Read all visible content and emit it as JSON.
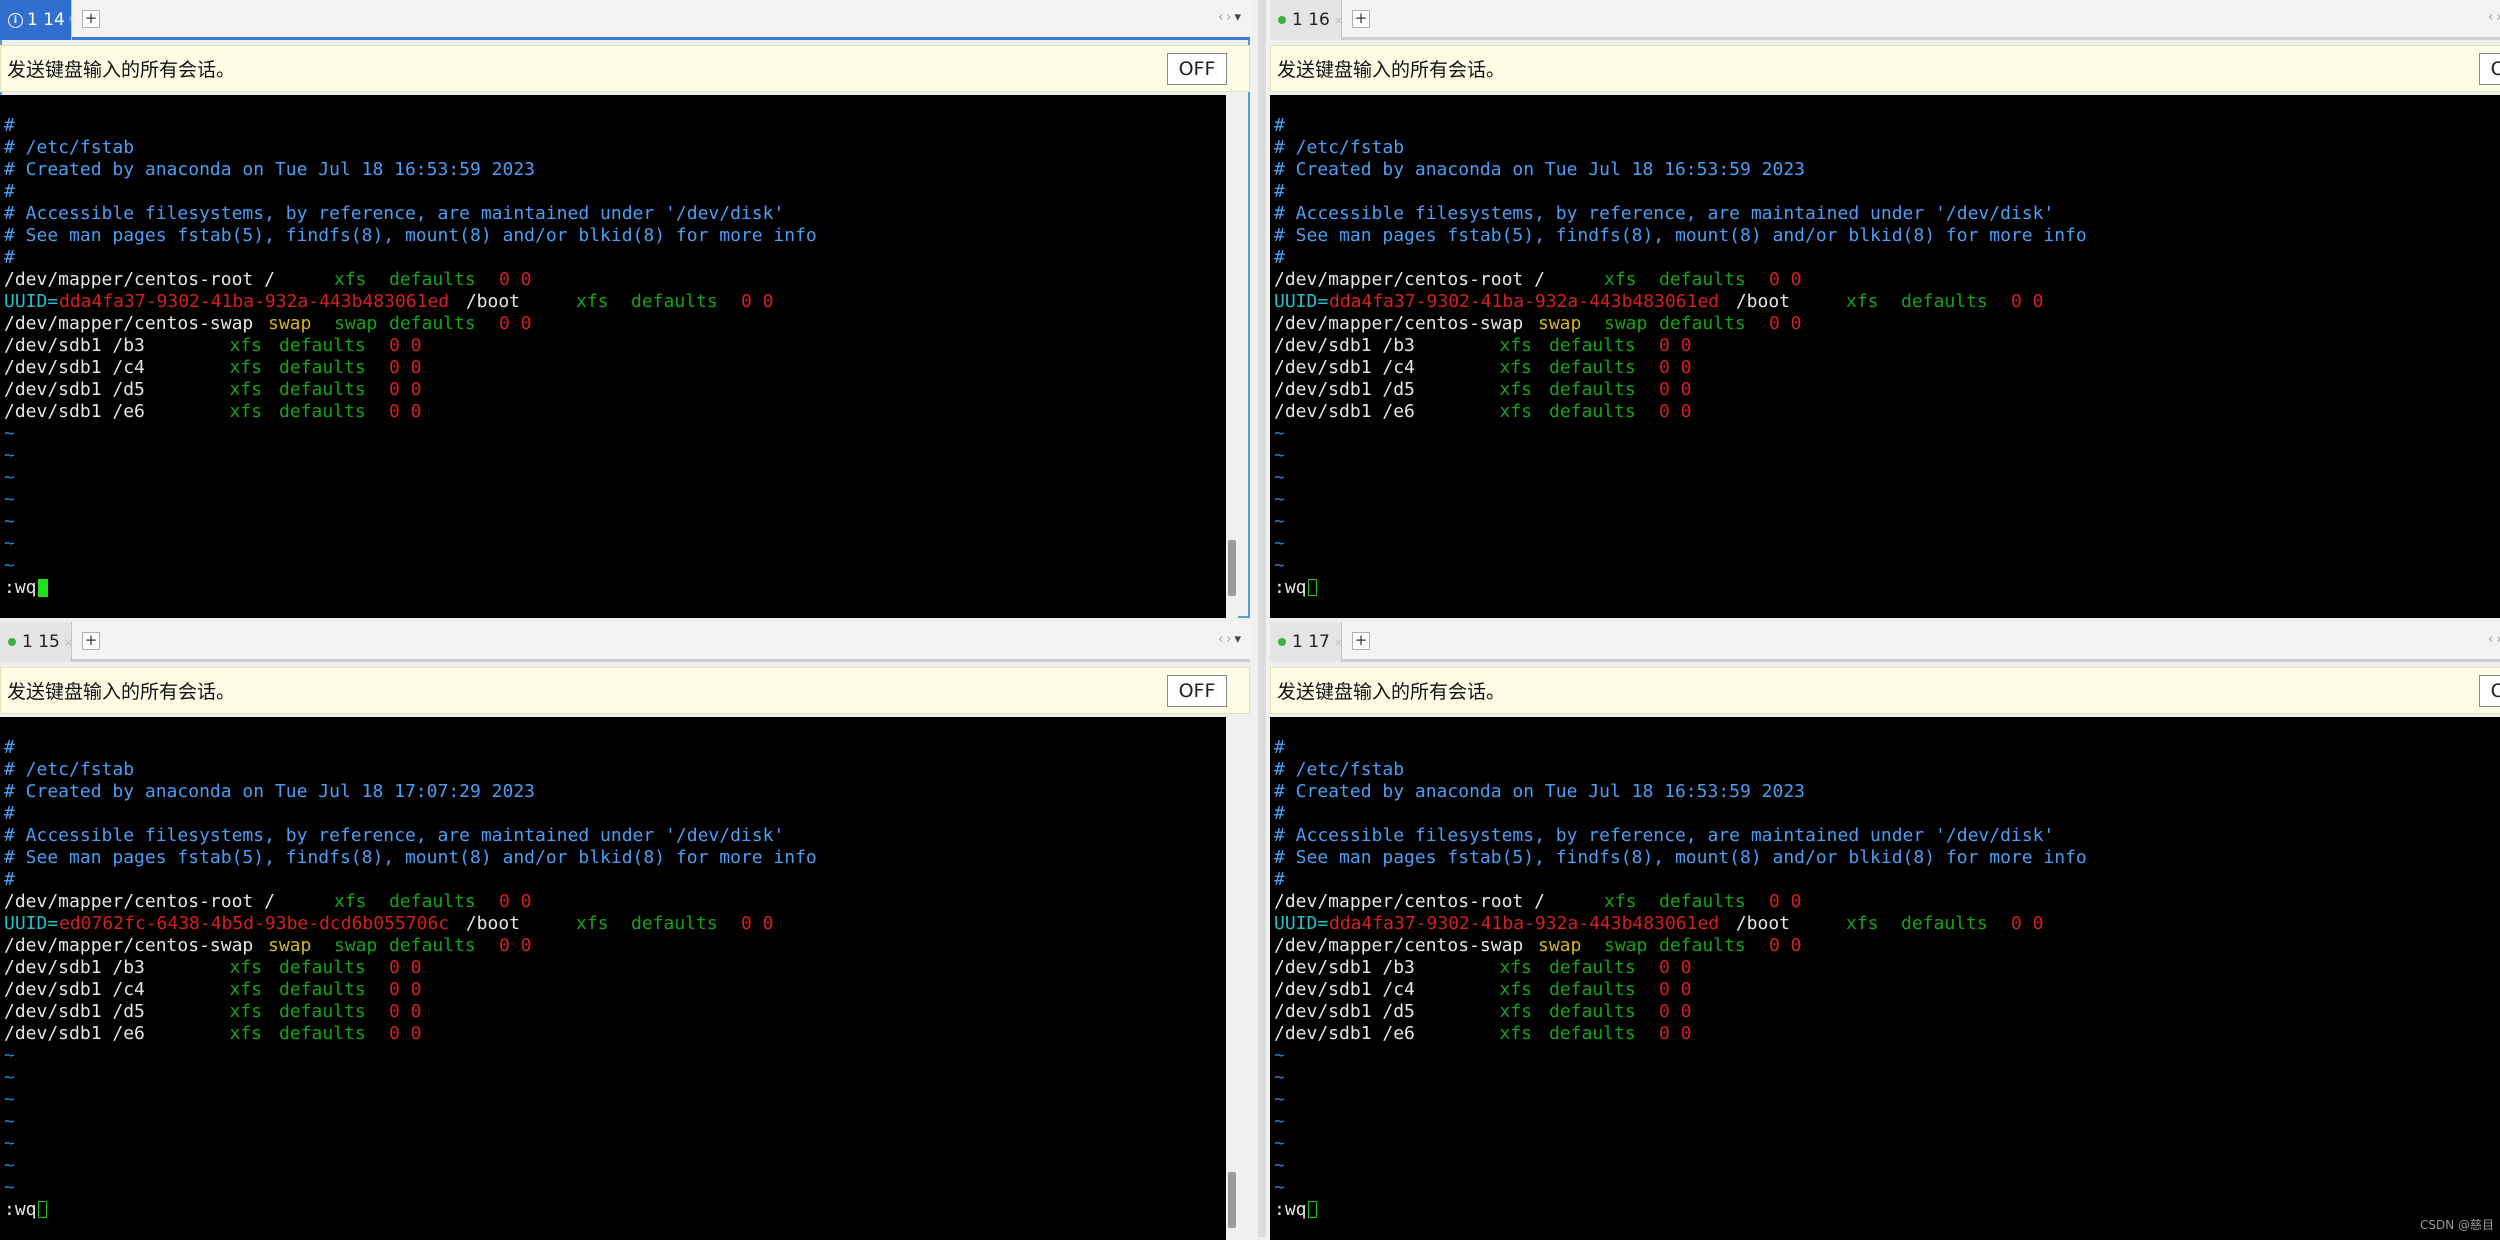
{
  "broadcast_text": "发送键盘输入的所有会话。",
  "off_label": "OFF",
  "add_tab_symbol": "+",
  "tab_nav_prev": "‹",
  "tab_nav_next": "›",
  "tab_nav_menu": "▾",
  "tilde": "~",
  "watermark": "CSDN @慈目",
  "colors": {
    "comment": "#4a9ff5",
    "keyword_green": "#14a514",
    "number_red": "#d81f1f",
    "swap_yellow": "#d6b61b",
    "uuid_cyan": "#23c0c8",
    "active_tab": "#2f6fd0"
  },
  "sessions": [
    {
      "tab_title": "1 14",
      "tab_modified": "*",
      "cmd": ":wq",
      "comments": [
        "#",
        "# /etc/fstab",
        "# Created by anaconda on Tue Jul 18 16:53:59 2023",
        "#",
        "# Accessible filesystems, by reference, are maintained under '/dev/disk'",
        "# See man pages fstab(5), findfs(8), mount(8) and/or blkid(8) for more info",
        "#"
      ],
      "uuid_value": "dda4fa37-9302-41ba-932a-443b483061ed"
    },
    {
      "tab_title": "1 16",
      "tab_modified": "×",
      "cmd": ":wq",
      "comments": [
        "#",
        "# /etc/fstab",
        "# Created by anaconda on Tue Jul 18 16:53:59 2023",
        "#",
        "# Accessible filesystems, by reference, are maintained under '/dev/disk'",
        "# See man pages fstab(5), findfs(8), mount(8) and/or blkid(8) for more info",
        "#"
      ],
      "uuid_value": "dda4fa37-9302-41ba-932a-443b483061ed"
    },
    {
      "tab_title": "1 15",
      "tab_modified": "×",
      "cmd": ":wq",
      "comments": [
        "#",
        "# /etc/fstab",
        "# Created by anaconda on Tue Jul 18 17:07:29 2023",
        "#",
        "# Accessible filesystems, by reference, are maintained under '/dev/disk'",
        "# See man pages fstab(5), findfs(8), mount(8) and/or blkid(8) for more info",
        "#"
      ],
      "uuid_value": "ed0762fc-6438-4b5d-93be-dcd6b055706c"
    },
    {
      "tab_title": "1 17",
      "tab_modified": "×",
      "cmd": ":wq",
      "comments": [
        "#",
        "# /etc/fstab",
        "# Created by anaconda on Tue Jul 18 16:53:59 2023",
        "#",
        "# Accessible filesystems, by reference, are maintained under '/dev/disk'",
        "# See man pages fstab(5), findfs(8), mount(8) and/or blkid(8) for more info",
        "#"
      ],
      "uuid_value": "dda4fa37-9302-41ba-932a-443b483061ed"
    }
  ],
  "fstab": {
    "root_line": {
      "device": "/dev/mapper/centos-root /",
      "fs": "xfs",
      "opts": "defaults",
      "nums": "0 0"
    },
    "boot_line": {
      "uuid_key": "UUID=",
      "mount": " /boot",
      "fs": "xfs",
      "opts": "defaults",
      "nums": "0 0"
    },
    "swap_line": {
      "device": "/dev/mapper/centos-swap ",
      "word": "swap",
      "fs": "swap",
      "opts": "defaults",
      "nums": "0 0"
    },
    "sdb_lines": [
      {
        "device": "/dev/sdb1 /b3",
        "fs": "xfs",
        "opts": "defaults",
        "nums": "0 0"
      },
      {
        "device": "/dev/sdb1 /c4",
        "fs": "xfs",
        "opts": "defaults",
        "nums": "0 0"
      },
      {
        "device": "/dev/sdb1 /d5",
        "fs": "xfs",
        "opts": "defaults",
        "nums": "0 0"
      },
      {
        "device": "/dev/sdb1 /e6",
        "fs": "xfs",
        "opts": "defaults",
        "nums": "0 0"
      }
    ]
  }
}
